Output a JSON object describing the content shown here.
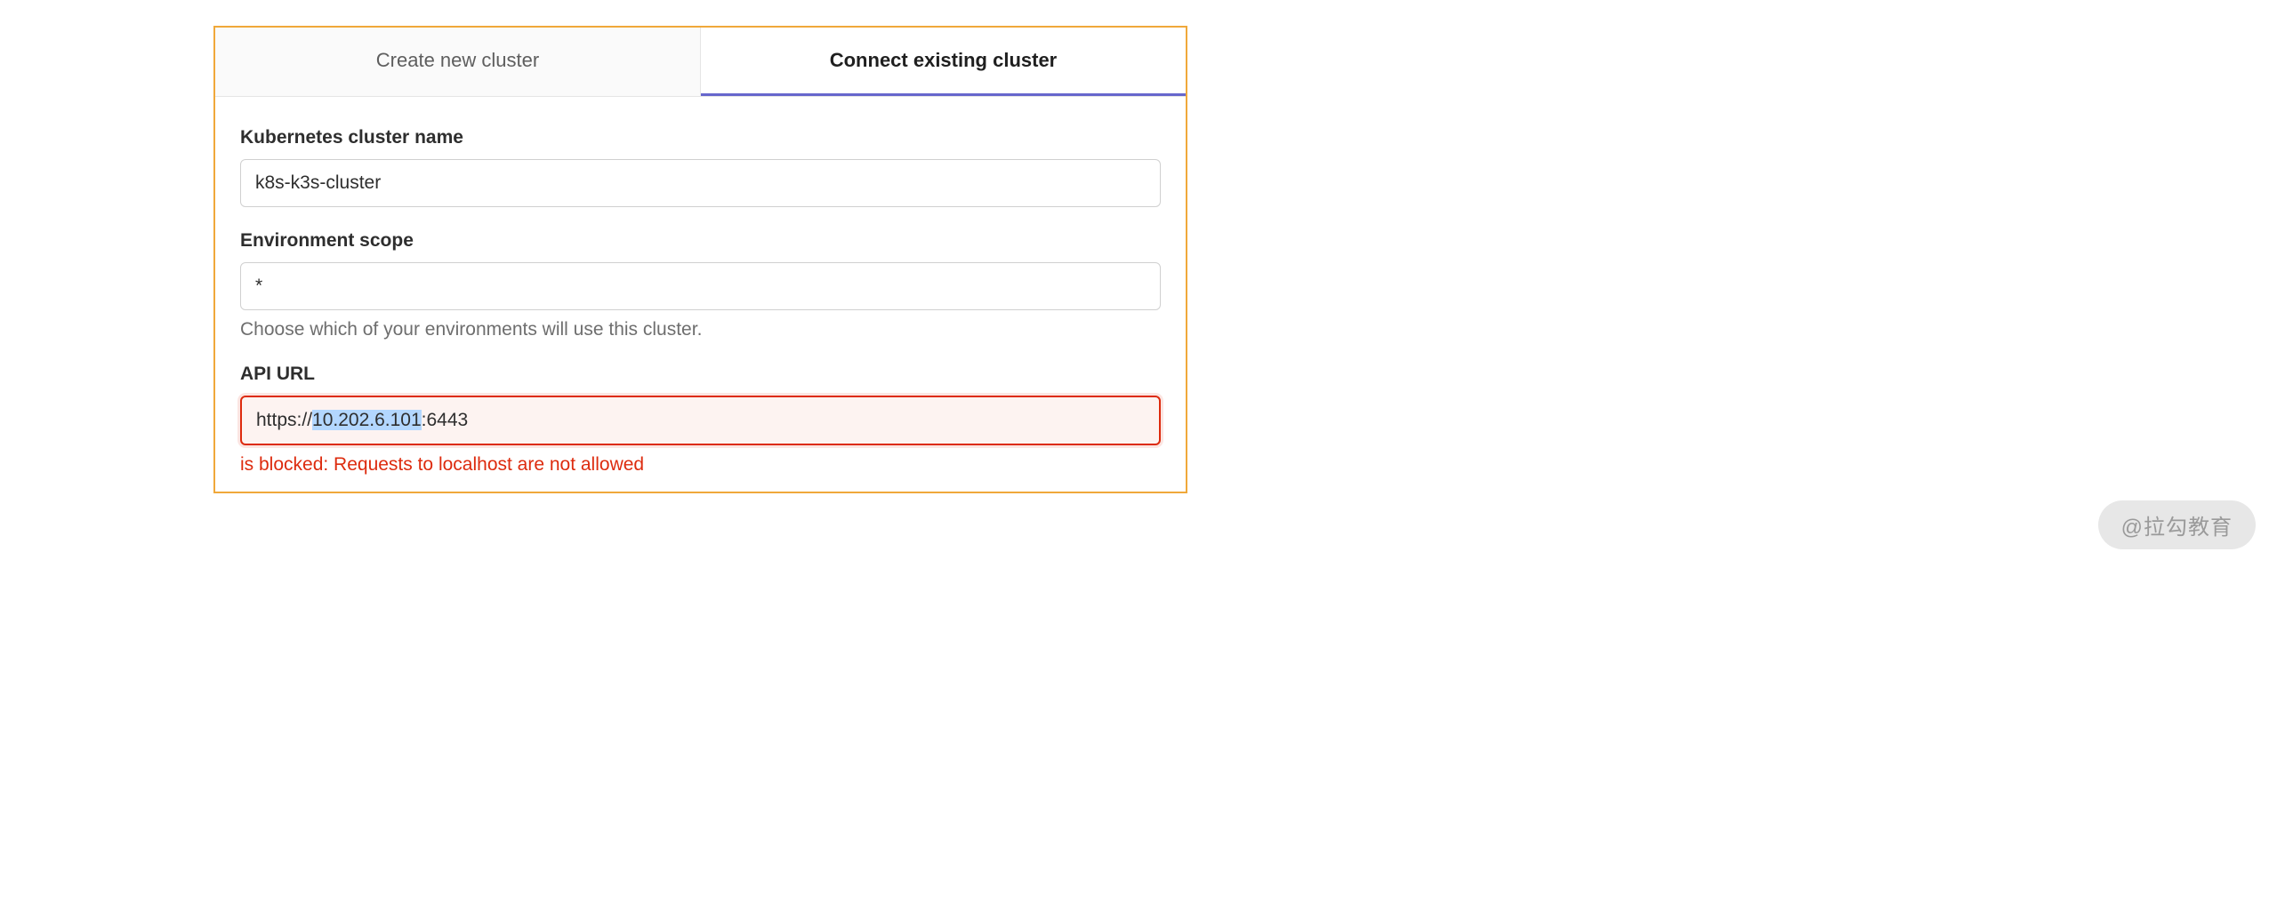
{
  "tabs": {
    "create": "Create new cluster",
    "connect": "Connect existing cluster"
  },
  "cluster_name": {
    "label": "Kubernetes cluster name",
    "value": "k8s-k3s-cluster"
  },
  "environment_scope": {
    "label": "Environment scope",
    "value": "*",
    "help": "Choose which of your environments will use this cluster."
  },
  "api_url": {
    "label": "API URL",
    "prefix": "https://",
    "selected": "10.202.6.101",
    "suffix": ":6443",
    "error": "is blocked: Requests to localhost are not allowed"
  },
  "watermark": "@拉勾教育"
}
